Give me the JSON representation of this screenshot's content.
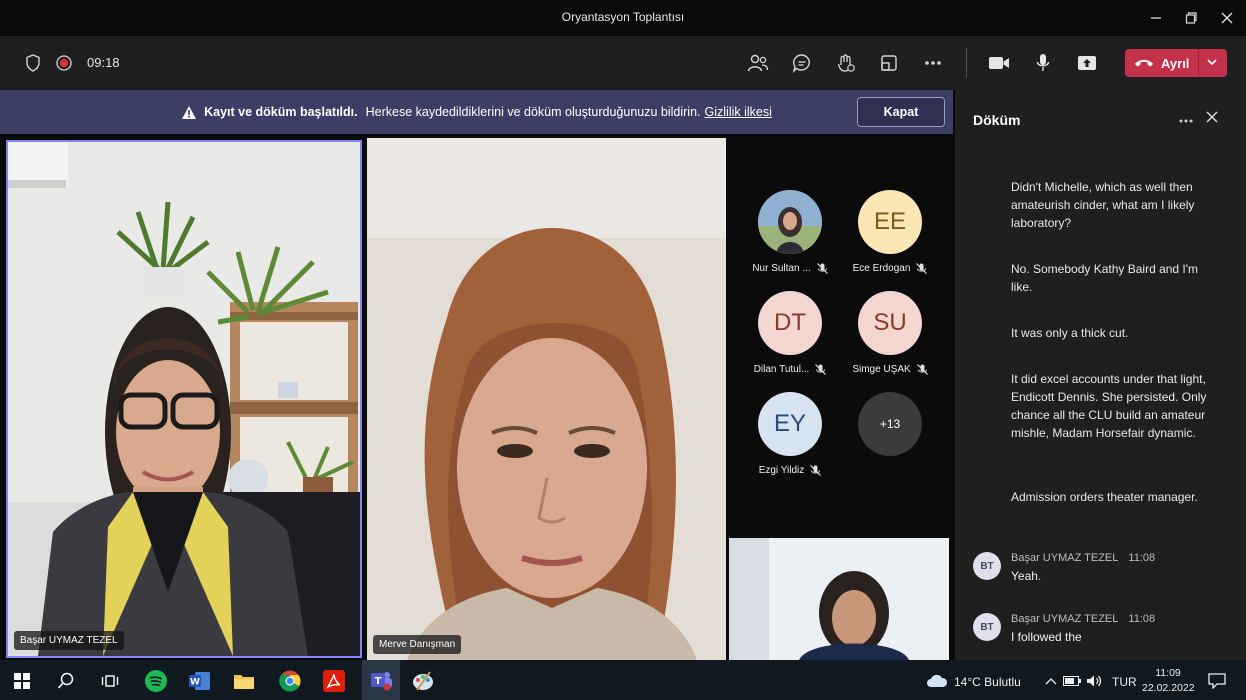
{
  "window": {
    "title": "Oryantasyon Toplantısı"
  },
  "toolbar": {
    "timer": "09:18",
    "leave_label": "Ayrıl"
  },
  "banner": {
    "bold": "Kayıt ve döküm başlatıldı.",
    "text": "Herkese kaydedildiklerini ve döküm oluşturduğunuzu bildirin.",
    "link": "Gizlilik ilkesi",
    "close_label": "Kapat"
  },
  "videos": {
    "main_left": "Başar UYMAZ TEZEL",
    "main_right": "Merve Danışman"
  },
  "participants": [
    {
      "name": "Nur Sultan ...",
      "initials": "",
      "color": "#6a8fb4"
    },
    {
      "name": "Ece Erdogan",
      "initials": "EE",
      "color": "#fbe7b5"
    },
    {
      "name": "Dilan Tutul...",
      "initials": "DT",
      "color": "#f2d6cf"
    },
    {
      "name": "Simge UŞAK",
      "initials": "SU",
      "color": "#f2d6cf"
    },
    {
      "name": "Ezgi Yildiz",
      "initials": "EY",
      "color": "#d7e3f1"
    }
  ],
  "overflow_count": "+13",
  "transcript": {
    "title": "Döküm",
    "messages": [
      "Didn't Michelle, which as well then amateurish cinder, what am I likely laboratory?",
      "No. Somebody Kathy Baird and I'm like.",
      "It was only a thick cut.",
      "It did excel accounts under that light, Endicott Dennis. She persisted. Only chance all the CLU build an amateur mishle, Madam Horsefair dynamic.",
      "Admission orders theater manager."
    ],
    "entries": [
      {
        "initials": "BT",
        "speaker": "Başar UYMAZ TEZEL",
        "time": "11:08",
        "text": "Yeah."
      },
      {
        "initials": "BT",
        "speaker": "Başar UYMAZ TEZEL",
        "time": "11:08",
        "text": "I followed the"
      }
    ]
  },
  "taskbar": {
    "weather": "14°C  Bulutlu",
    "lang": "TUR",
    "time": "11:09",
    "date": "22.02.2022"
  },
  "colors": {
    "accent": "#7f85f5",
    "leave": "#c4314b",
    "banner": "#3d3e66"
  }
}
